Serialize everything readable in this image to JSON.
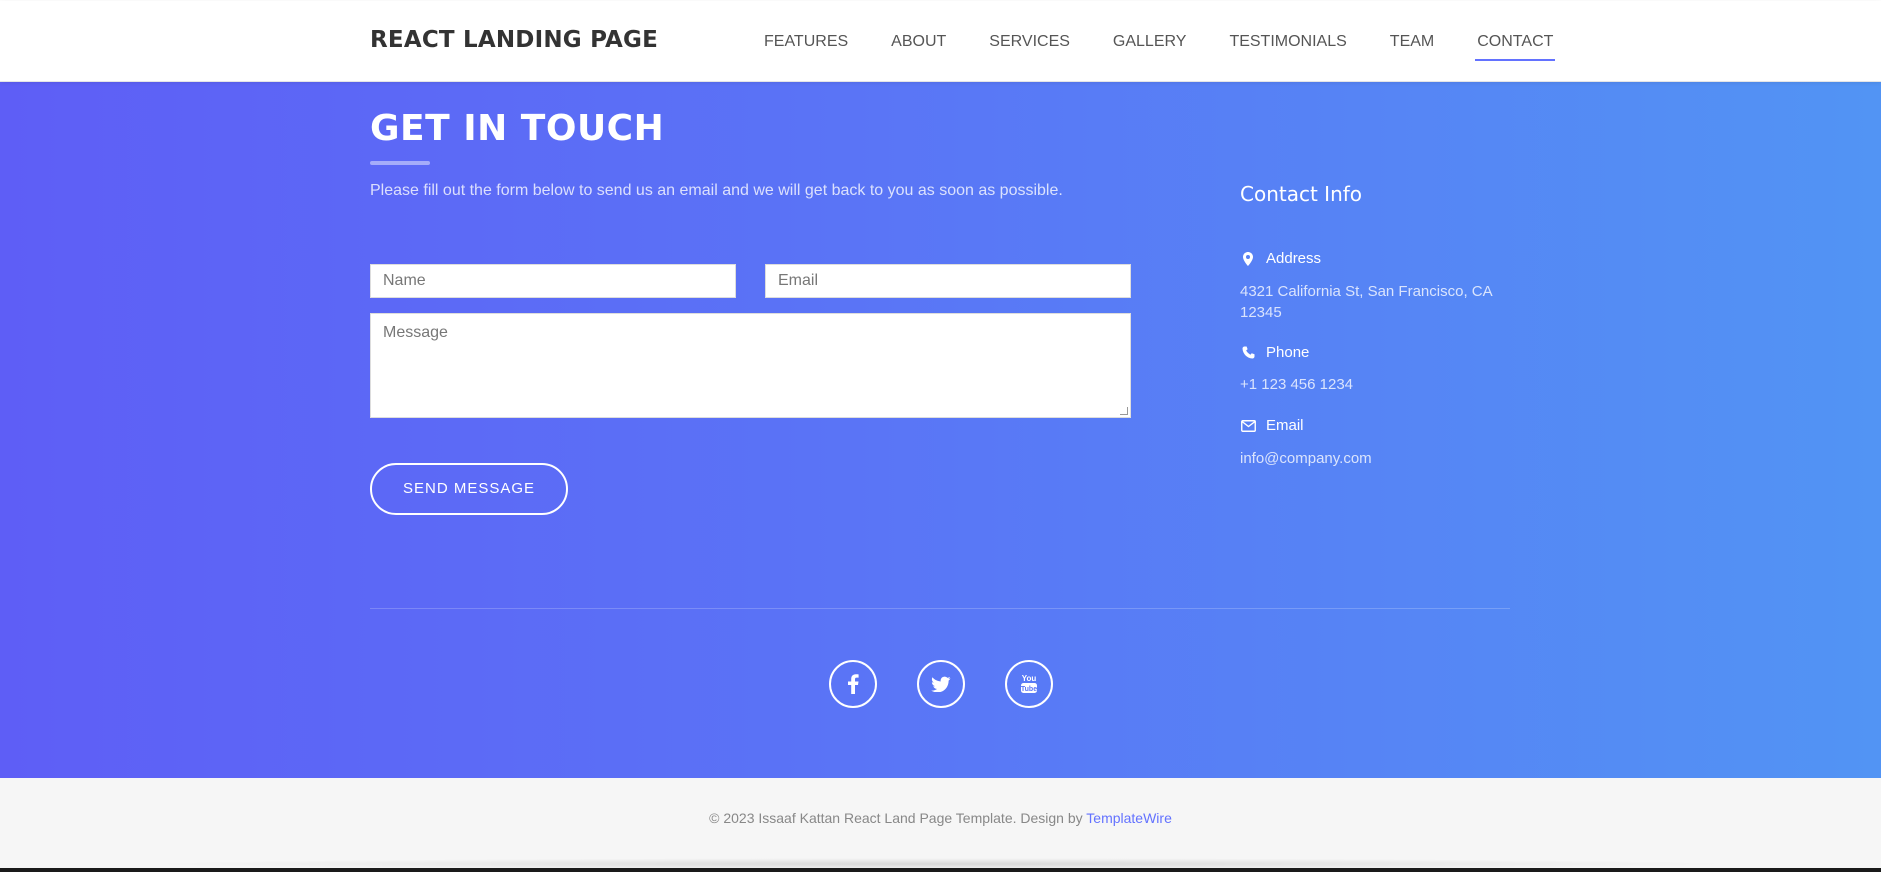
{
  "nav": {
    "brand": "REACT LANDING PAGE",
    "links": [
      {
        "label": "FEATURES"
      },
      {
        "label": "ABOUT"
      },
      {
        "label": "SERVICES"
      },
      {
        "label": "GALLERY"
      },
      {
        "label": "TESTIMONIALS"
      },
      {
        "label": "TEAM"
      },
      {
        "label": "CONTACT",
        "active": true
      }
    ]
  },
  "contact": {
    "title": "GET IN TOUCH",
    "description": "Please fill out the form below to send us an email and we will get back to you as soon as possible.",
    "form": {
      "name_placeholder": "Name",
      "email_placeholder": "Email",
      "message_placeholder": "Message",
      "submit_label": "SEND MESSAGE"
    },
    "info": {
      "title": "Contact Info",
      "address_label": "Address",
      "address_value": "4321 California St, San Francisco, CA 12345",
      "phone_label": "Phone",
      "phone_value": "+1 123 456 1234",
      "email_label": "Email",
      "email_value": "info@company.com"
    },
    "social": [
      {
        "icon": "facebook-icon"
      },
      {
        "icon": "twitter-icon"
      },
      {
        "icon": "youtube-icon"
      }
    ]
  },
  "footer": {
    "copyright": "© 2023 Issaaf Kattan React Land Page Template. Design by",
    "link_label": "TemplateWire"
  },
  "colors": {
    "gradient_start": "#5e5ef6",
    "gradient_end": "#5294f4",
    "accent": "#6372ff"
  }
}
